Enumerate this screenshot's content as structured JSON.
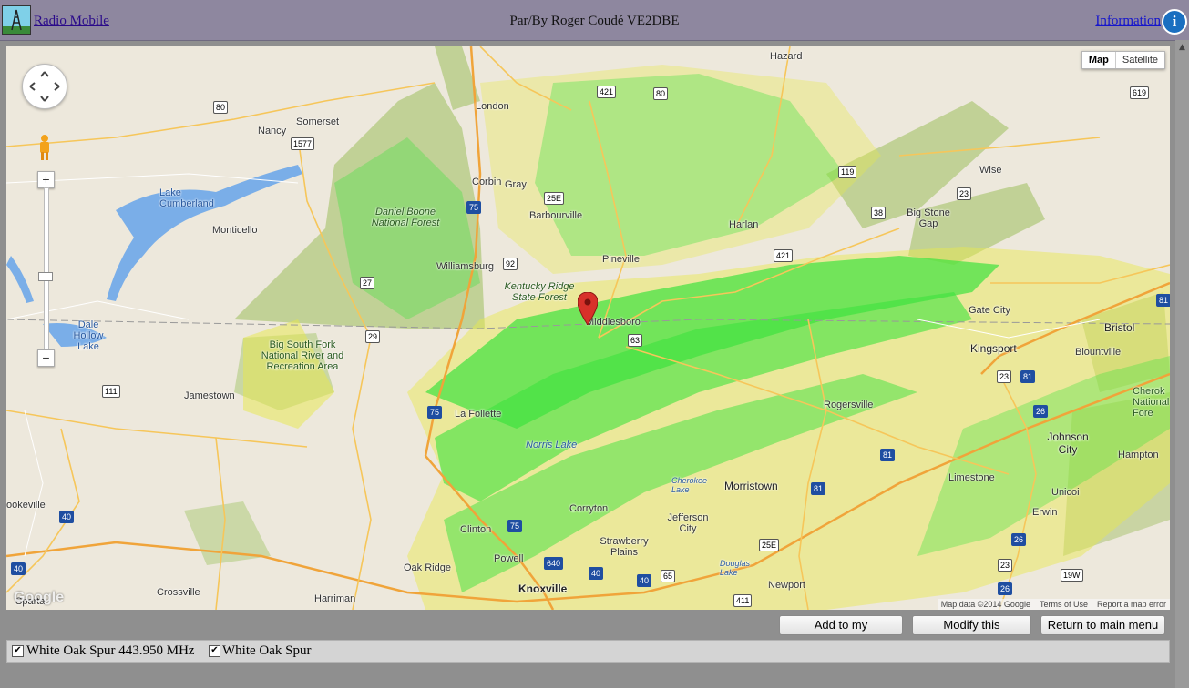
{
  "header": {
    "app_link": "Radio Mobile",
    "author": "Par/By Roger Coudé VE2DBE",
    "info_link": "Information",
    "info_icon": "i"
  },
  "map": {
    "map_type": {
      "map": "Map",
      "satellite": "Satellite"
    },
    "zoom_in": "+",
    "zoom_out": "−",
    "google": "Google",
    "attribution": {
      "data": "Map data ©2014 Google",
      "terms": "Terms of Use",
      "report": "Report a map error"
    },
    "labels": {
      "hazard": "Hazard",
      "london": "London",
      "somerset": "Somerset",
      "nancy": "Nancy",
      "corbin": "Corbin",
      "gray": "Gray",
      "barbourville": "Barbourville",
      "harlan": "Harlan",
      "wise": "Wise",
      "big_stone_gap": "Big Stone Gap",
      "monticello": "Monticello",
      "lake_cumberland": "Lake Cumberland",
      "williamsburg": "Williamsburg",
      "pineville": "Pineville",
      "kentucky_ridge": "Kentucky Ridge State Forest",
      "middlesboro": "Middlesboro",
      "gate_city": "Gate City",
      "bristol": "Bristol",
      "kingsport": "Kingsport",
      "blountville": "Blountville",
      "dale_hollow": "Dale Hollow Lake",
      "big_south_fork": "Big South Fork National River and Recreation Area",
      "jamestown": "Jamestown",
      "la_follette": "La Follette",
      "rogersville": "Rogersville",
      "johnson_city": "Johnson City",
      "hampton": "Hampton",
      "limestone": "Limestone",
      "morristown": "Morristown",
      "unicoi": "Unicoi",
      "erwin": "Erwin",
      "cookeville": "ookeville",
      "clinton": "Clinton",
      "jefferson_city": "Jefferson City",
      "strawberry_plains": "Strawberry Plains",
      "corryton": "Corryton",
      "oak_ridge": "Oak Ridge",
      "knoxville": "Knoxville",
      "harriman": "Harriman",
      "crossville": "Crossville",
      "sparta": "Sparta",
      "newport": "Newport",
      "powell": "Powell",
      "daniel_boone_nf": "Daniel Boone National Forest",
      "cherokee_nf": "Cherok National Fore",
      "norris_lake": "Norris Lake",
      "cherokee_lake": "Cherokee Lake",
      "douglas_lake": "Douglas Lake"
    }
  },
  "buttons": {
    "add": "Add to my coverages",
    "modify": "Modify this coverage",
    "return": "Return to main menu"
  },
  "legend": {
    "item1": "White Oak Spur 443.950 MHz",
    "item2": "White Oak Spur",
    "item1_checked": true,
    "item2_checked": true
  },
  "colors": {
    "header_bg": "#8e879f",
    "coverage_green": "#3ee23e",
    "coverage_yellow": "#e8e84a",
    "forest": "#b9cc8a"
  }
}
